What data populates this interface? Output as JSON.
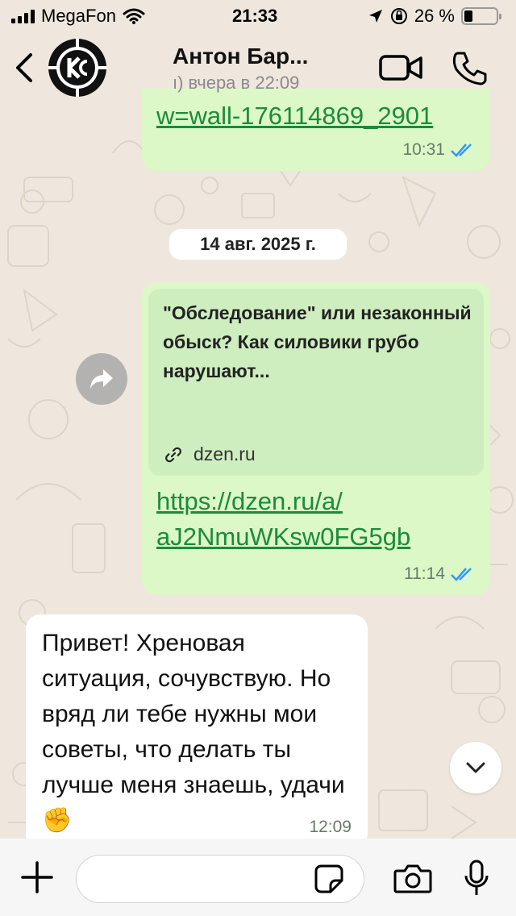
{
  "status_bar": {
    "carrier": "MegaFon",
    "time": "21:33",
    "battery": "26 %",
    "battery_level": 0.26
  },
  "header": {
    "contact_name": "Антон Бар...",
    "last_seen": "ı) вчера в 22:09"
  },
  "messages": [
    {
      "direction": "out",
      "text": "w=wall-176114869_2901",
      "time": "10:31",
      "status": "read"
    },
    {
      "direction": "out",
      "preview_title": "\"Обследование\" или незаконный обыск? Как силовики грубо нарушают...",
      "preview_domain": "dzen.ru",
      "link_line1": "https://dzen.ru/a/",
      "link_line2": "aJ2NmuWKsw0FG5gb",
      "time": "11:14",
      "status": "read"
    },
    {
      "direction": "in",
      "text": "Привет! Хреновая ситуация, сочувствую. Но вряд ли тебе нужны мои советы, что делать ты лучше меня знаешь, удачи ✊",
      "time": "12:09"
    }
  ],
  "date_separator": "14 авг. 2025 г.",
  "input": {
    "placeholder": ""
  },
  "colors": {
    "outgoing_bubble": "#dcf8c6",
    "incoming_bubble": "#ffffff",
    "link": "#1b8b3a",
    "read_ticks": "#3497f9"
  },
  "icons": [
    "back-icon",
    "video-call-icon",
    "phone-icon",
    "forward-icon",
    "link-icon",
    "chevron-down-icon",
    "plus-icon",
    "sticker-icon",
    "camera-icon",
    "microphone-icon",
    "read-ticks-icon",
    "location-arrow-icon",
    "orientation-lock-icon",
    "wifi-icon"
  ]
}
